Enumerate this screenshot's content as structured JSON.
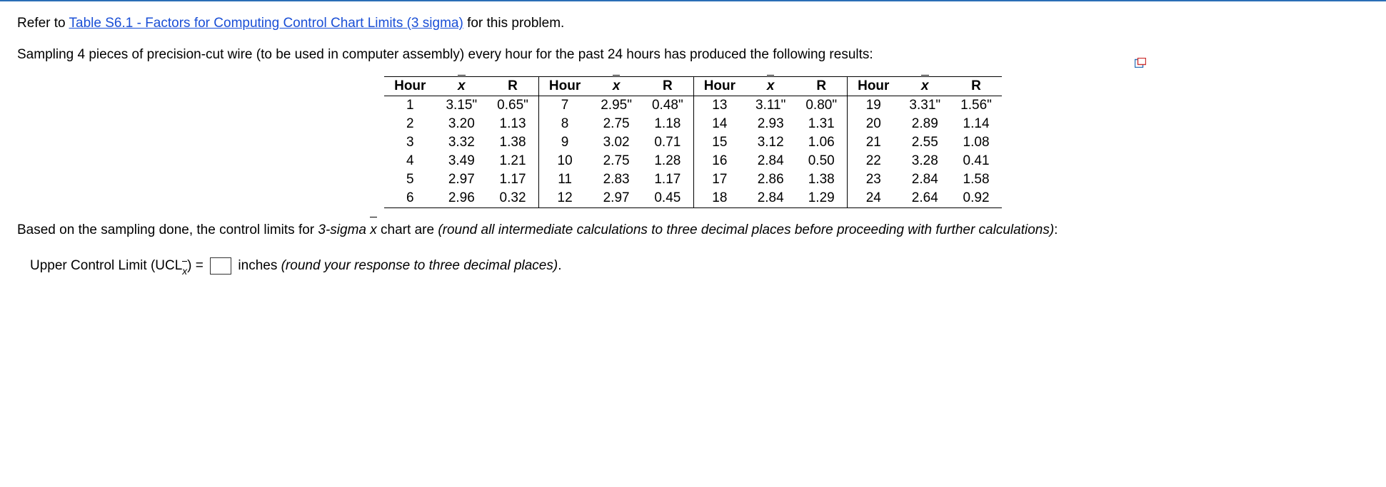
{
  "intro": {
    "prefix": "Refer to ",
    "link_text": "Table S6.1 - Factors for Computing Control Chart Limits (3 sigma)",
    "suffix": " for this problem."
  },
  "context": "Sampling 4 pieces of precision-cut wire (to be used in computer assembly) every hour for the past 24 hours has produced the following results:",
  "table": {
    "headers": {
      "hour": "Hour",
      "xbar": "x",
      "r": "R"
    },
    "groups": [
      [
        {
          "hour": "1",
          "x": "3.15\"",
          "r": "0.65\""
        },
        {
          "hour": "2",
          "x": "3.20",
          "r": "1.13"
        },
        {
          "hour": "3",
          "x": "3.32",
          "r": "1.38"
        },
        {
          "hour": "4",
          "x": "3.49",
          "r": "1.21"
        },
        {
          "hour": "5",
          "x": "2.97",
          "r": "1.17"
        },
        {
          "hour": "6",
          "x": "2.96",
          "r": "0.32"
        }
      ],
      [
        {
          "hour": "7",
          "x": "2.95\"",
          "r": "0.48\""
        },
        {
          "hour": "8",
          "x": "2.75",
          "r": "1.18"
        },
        {
          "hour": "9",
          "x": "3.02",
          "r": "0.71"
        },
        {
          "hour": "10",
          "x": "2.75",
          "r": "1.28"
        },
        {
          "hour": "11",
          "x": "2.83",
          "r": "1.17"
        },
        {
          "hour": "12",
          "x": "2.97",
          "r": "0.45"
        }
      ],
      [
        {
          "hour": "13",
          "x": "3.11\"",
          "r": "0.80\""
        },
        {
          "hour": "14",
          "x": "2.93",
          "r": "1.31"
        },
        {
          "hour": "15",
          "x": "3.12",
          "r": "1.06"
        },
        {
          "hour": "16",
          "x": "2.84",
          "r": "0.50"
        },
        {
          "hour": "17",
          "x": "2.86",
          "r": "1.38"
        },
        {
          "hour": "18",
          "x": "2.84",
          "r": "1.29"
        }
      ],
      [
        {
          "hour": "19",
          "x": "3.31\"",
          "r": "1.56\""
        },
        {
          "hour": "20",
          "x": "2.89",
          "r": "1.14"
        },
        {
          "hour": "21",
          "x": "2.55",
          "r": "1.08"
        },
        {
          "hour": "22",
          "x": "3.28",
          "r": "0.41"
        },
        {
          "hour": "23",
          "x": "2.84",
          "r": "1.58"
        },
        {
          "hour": "24",
          "x": "2.64",
          "r": "0.92"
        }
      ]
    ]
  },
  "question": {
    "pre": "Based on the sampling done, the control limits for ",
    "em1": "3-sigma",
    "mid": " chart are ",
    "em2": "(round all intermediate calculations to three decimal places before proceeding with further calculations)",
    "post": ":"
  },
  "answer": {
    "label_pre": "Upper Control Limit (UCL",
    "label_post": ") = ",
    "unit": "inches ",
    "hint": "(round your response to three decimal places)",
    "period": "."
  },
  "icon": {
    "popout": "popout-icon"
  }
}
